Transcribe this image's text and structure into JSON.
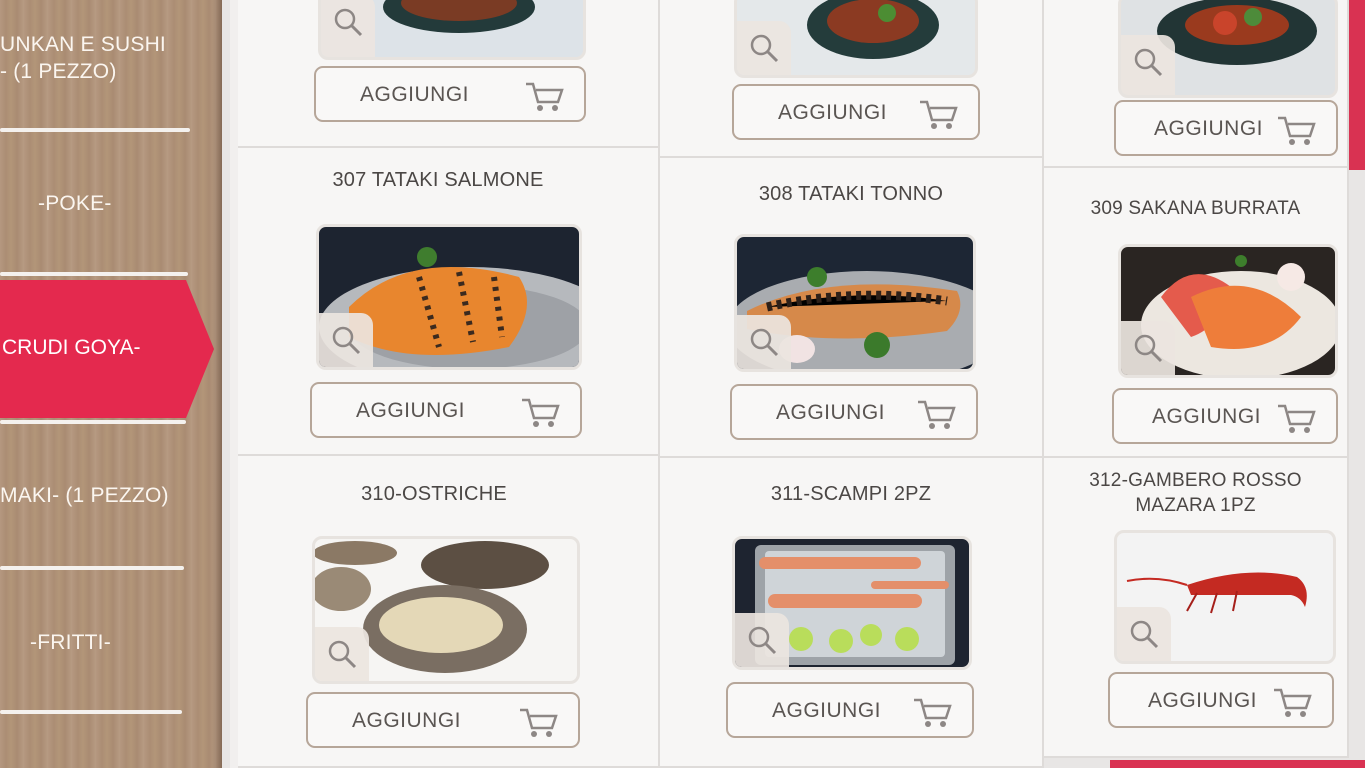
{
  "sidebar": {
    "categories": [
      {
        "line1": "UNKAN E SUSHI",
        "line2": "- (1 PEZZO)"
      },
      {
        "line1": "-POKE-"
      },
      {
        "line1": "CRUDI GOYA-",
        "active": true
      },
      {
        "line1": "MAKI- (1 PEZZO)"
      },
      {
        "line1": "-FRITTI-"
      }
    ]
  },
  "products": [
    {
      "title": "",
      "button": "AGGIUNGI",
      "icon": "salad-plate"
    },
    {
      "title": "",
      "button": "AGGIUNGI",
      "icon": "salad-plate"
    },
    {
      "title": "",
      "button": "AGGIUNGI",
      "icon": "salad-plate"
    },
    {
      "title": "307 TATAKI SALMONE",
      "button": "AGGIUNGI",
      "icon": "tataki"
    },
    {
      "title": "308 TATAKI TONNO",
      "button": "AGGIUNGI",
      "icon": "tataki"
    },
    {
      "title": "309 SAKANA BURRATA",
      "button": "AGGIUNGI",
      "icon": "burrata"
    },
    {
      "title": "310-OSTRICHE",
      "button": "AGGIUNGI",
      "icon": "oysters"
    },
    {
      "title": "311-SCAMPI 2PZ",
      "button": "AGGIUNGI",
      "icon": "scampi"
    },
    {
      "title_line1": "312-GAMBERO ROSSO",
      "title_line2": "MAZARA 1PZ",
      "button": "AGGIUNGI",
      "icon": "red-shrimp"
    }
  ],
  "colors": {
    "accent": "#e4294e",
    "button_border": "#b6a699",
    "text": "#4b4745"
  }
}
